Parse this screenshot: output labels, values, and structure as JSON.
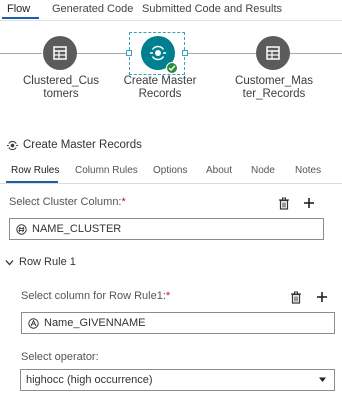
{
  "top_tabs": [
    "Flow",
    "Generated Code",
    "Submitted Code and Results"
  ],
  "flow": {
    "nodes": [
      {
        "label_line1": "Clustered_Cus",
        "label_line2": "tomers",
        "icon": "table-icon"
      },
      {
        "label_line1": "Create Master",
        "label_line2": "Records",
        "icon": "create-master-records-icon",
        "status": "success"
      },
      {
        "label_line1": "Customer_Mas",
        "label_line2": "ter_Records",
        "icon": "table-icon"
      }
    ]
  },
  "properties": {
    "title": "Create Master Records",
    "tabs": [
      "Row Rules",
      "Column Rules",
      "Options",
      "About",
      "Node",
      "Notes"
    ],
    "cluster": {
      "label": "Select Cluster Column:",
      "required_mark": "*",
      "value": "NAME_CLUSTER",
      "value_icon": "numeric-column-icon"
    },
    "row_rule": {
      "title": "Row Rule 1",
      "column_label": "Select column for Row Rule1:",
      "required_mark": "*",
      "column_value": "Name_GIVENNAME",
      "column_icon": "character-column-icon",
      "operator_label": "Select operator:",
      "operator_value": "highocc (high occurrence)"
    }
  },
  "colors": {
    "accent": "#1a5fa8",
    "active_node": "#00808f",
    "node": "#5b5b5b",
    "success": "#2e8b3a",
    "required": "#c8102e"
  }
}
